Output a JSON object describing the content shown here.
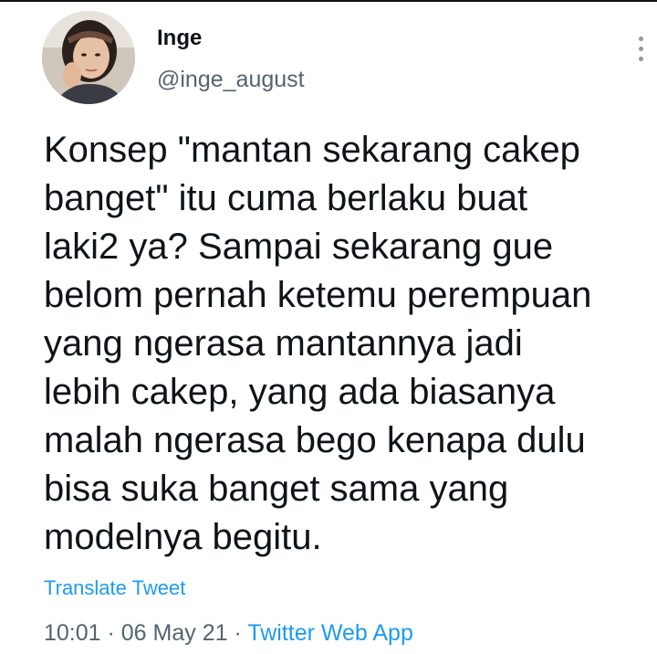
{
  "author": {
    "display_name": "Inge",
    "handle": "@inge_august",
    "avatar_icon": "user-photo-avatar"
  },
  "more_icon": "more-options-icon",
  "tweet": {
    "lines": [
      "Konsep \"mantan sekarang cakep",
      "banget\" itu cuma berlaku buat",
      "laki2 ya? Sampai sekarang gue",
      "belom pernah ketemu perempuan",
      "yang ngerasa mantannya jadi",
      "lebih cakep, yang ada biasanya",
      "malah ngerasa bego kenapa dulu",
      "bisa suka banget sama yang",
      "modelnya begitu."
    ]
  },
  "translate_label": "Translate Tweet",
  "meta": {
    "time": "10:01",
    "separator": " · ",
    "date": "06 May 21",
    "source": "Twitter Web App"
  },
  "colors": {
    "link": "#1d9bf0",
    "secondary_text": "#536471",
    "primary_text": "#0f1419"
  }
}
